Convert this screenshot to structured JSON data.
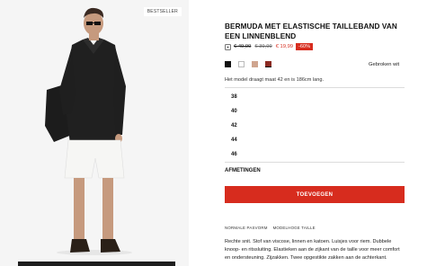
{
  "product": {
    "badge": "BESTSELLER",
    "title": "BERMUDA MET ELASTISCHE TAILLEBAND VAN EEN LINNENBLEND",
    "price_original": "€ 49,99",
    "price_previous": "€ 39,99",
    "price_current": "€ 19,99",
    "discount": "-60%",
    "color_name": "Gebroken wit",
    "model_info": "Het model draagt maat 42 en is 186cm lang.",
    "swatch_colors": [
      "#111111",
      "#ffffff",
      "#cfa58f",
      "#8b2a22"
    ]
  },
  "sizes": [
    "38",
    "40",
    "42",
    "44",
    "46"
  ],
  "measurements_label": "AFMETINGEN",
  "add_button_label": "TOEVOEGEN",
  "fit_tags": [
    "NORMALE PASVORM",
    "MODELHOGE TAILLE"
  ],
  "description": "Rechte snit. Stof van viscose, linnen en katoen. Luisjes voor riem. Dubbele knoop- en ritssluiting. Elastieken aan de zijkant van de taille voor meer comfort en ondersteuning. Zijzakken. Twee opgestikte zakken aan de achterkant.",
  "colors": {
    "accent": "#d72c1e",
    "text": "#1a1a1a"
  }
}
